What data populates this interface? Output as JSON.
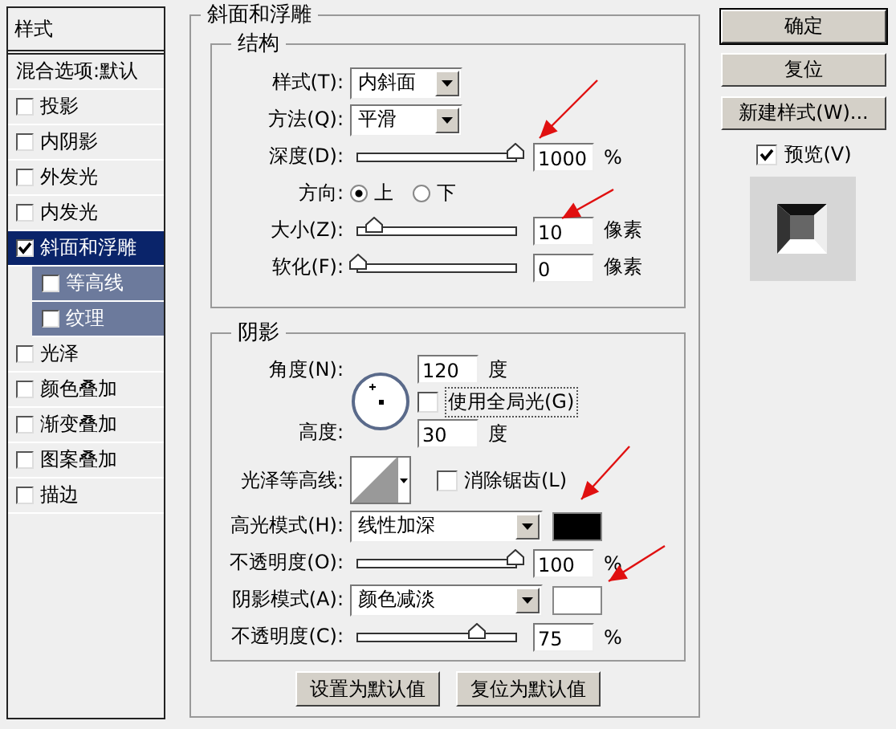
{
  "sidebar": {
    "title": "样式",
    "items": [
      {
        "kind": "plain",
        "label": "混合选项:默认",
        "selected": false
      },
      {
        "kind": "check",
        "label": "投影",
        "checked": false,
        "selected": false
      },
      {
        "kind": "check",
        "label": "内阴影",
        "checked": false,
        "selected": false
      },
      {
        "kind": "check",
        "label": "外发光",
        "checked": false,
        "selected": false
      },
      {
        "kind": "check",
        "label": "内发光",
        "checked": false,
        "selected": false
      },
      {
        "kind": "check",
        "label": "斜面和浮雕",
        "checked": true,
        "selected": true,
        "children": [
          {
            "label": "等高线",
            "checked": false,
            "selected": false
          },
          {
            "label": "纹理",
            "checked": false,
            "selected": false
          }
        ]
      },
      {
        "kind": "check",
        "label": "光泽",
        "checked": false,
        "selected": false
      },
      {
        "kind": "check",
        "label": "颜色叠加",
        "checked": false,
        "selected": false
      },
      {
        "kind": "check",
        "label": "渐变叠加",
        "checked": false,
        "selected": false
      },
      {
        "kind": "check",
        "label": "图案叠加",
        "checked": false,
        "selected": false
      },
      {
        "kind": "check",
        "label": "描边",
        "checked": false,
        "selected": false
      }
    ]
  },
  "panel": {
    "title": "斜面和浮雕",
    "structure": {
      "title": "结构",
      "rows": [
        {
          "kind": "select",
          "label": "样式(T):",
          "value": "内斜面"
        },
        {
          "kind": "select",
          "label": "方法(Q):",
          "value": "平滑"
        },
        {
          "kind": "slider",
          "label": "深度(D):",
          "level": 1,
          "value": "1000",
          "unit": "%"
        },
        {
          "kind": "radio",
          "label": "方向:",
          "options": [
            {
              "label": "上",
              "selected": true
            },
            {
              "label": "下",
              "selected": false
            }
          ]
        },
        {
          "kind": "slider",
          "label": "大小(Z):",
          "level": 0.1,
          "value": "10",
          "unit": "像素"
        },
        {
          "kind": "slider",
          "label": "软化(F):",
          "level": 0,
          "value": "0",
          "unit": "像素"
        }
      ]
    },
    "shading": {
      "title": "阴影",
      "angle": {
        "label": "角度(N):",
        "value": "120",
        "unit": "度"
      },
      "global_light": {
        "label": "使用全局光(G)",
        "checked": false
      },
      "altitude": {
        "label": "高度:",
        "value": "30",
        "unit": "度"
      },
      "gloss_contour": {
        "label": "光泽等高线:"
      },
      "anti_alias": {
        "label": "消除锯齿(L)",
        "checked": false
      },
      "rows": [
        {
          "kind": "mode",
          "label": "高光模式(H):",
          "value": "线性加深",
          "color": "#000000"
        },
        {
          "kind": "slider",
          "label": "不透明度(O):",
          "level": 1,
          "value": "100",
          "unit": "%"
        },
        {
          "kind": "mode",
          "label": "阴影模式(A):",
          "value": "颜色减淡",
          "color": "#ffffff"
        },
        {
          "kind": "slider",
          "label": "不透明度(C):",
          "level": 0.75,
          "value": "75",
          "unit": "%"
        }
      ]
    },
    "buttons": [
      "设置为默认值",
      "复位为默认值"
    ]
  },
  "actions": {
    "buttons": [
      "确定",
      "复位",
      "新建样式(W)..."
    ],
    "preview": {
      "label": "预览(V)",
      "checked": true
    }
  }
}
